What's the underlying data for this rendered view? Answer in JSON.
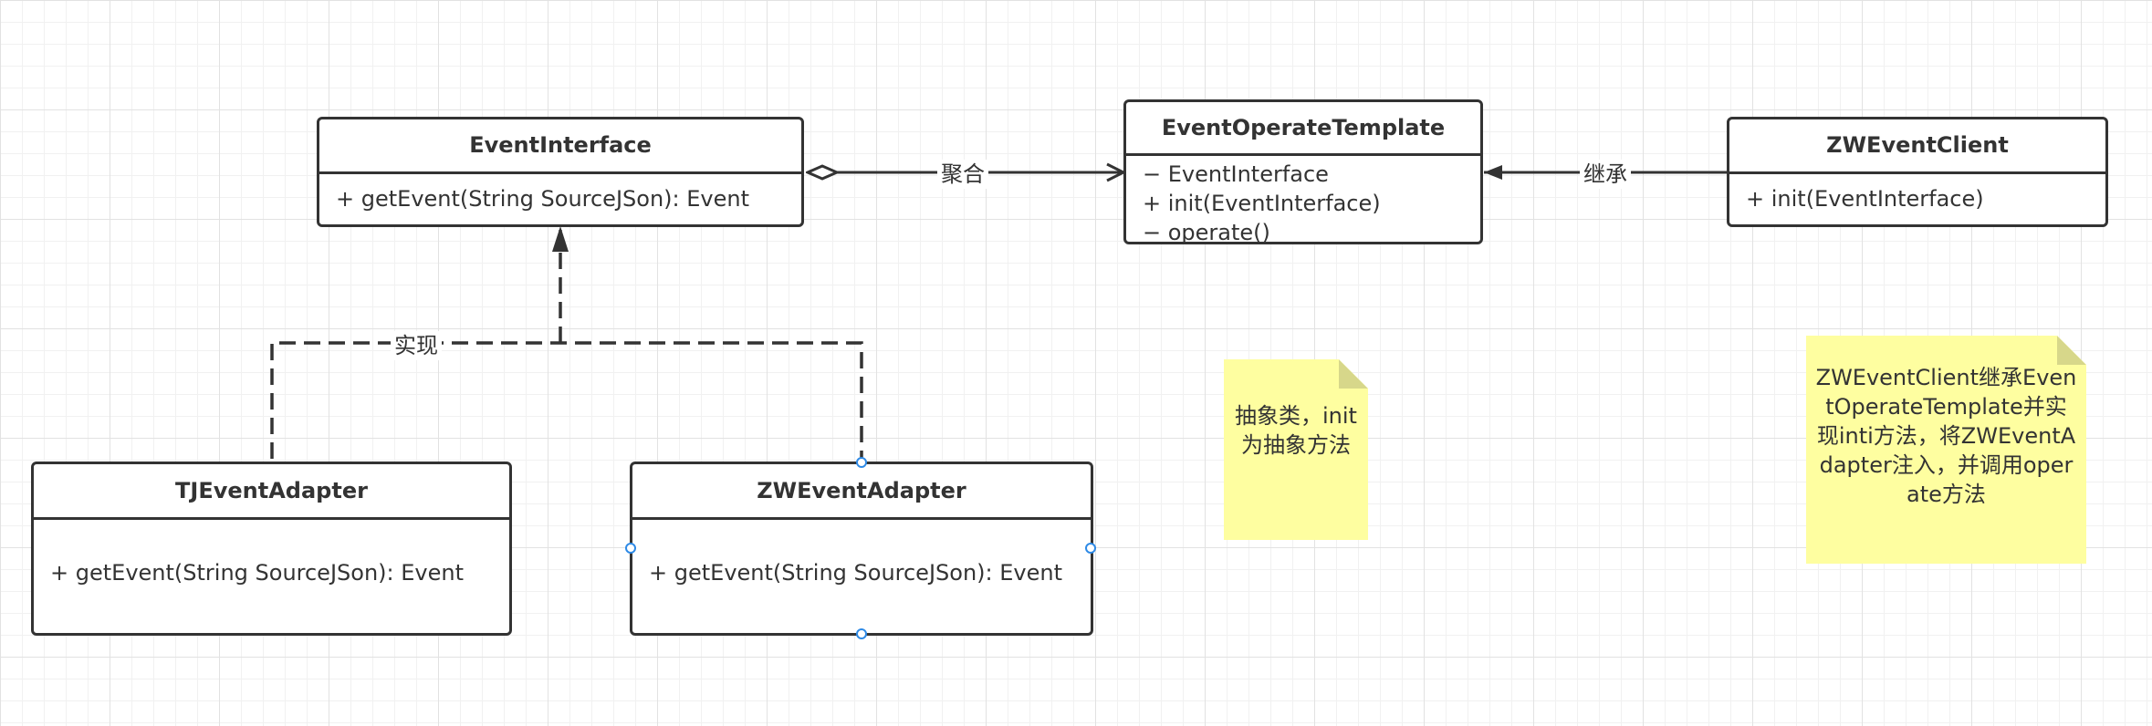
{
  "classes": {
    "event_interface": {
      "name": "EventInterface",
      "members": [
        "+ getEvent(String SourceJSon): Event"
      ]
    },
    "event_operate_template": {
      "name": "EventOperateTemplate",
      "members": [
        "− EventInterface",
        "+ init(EventInterface)",
        "− operate()"
      ]
    },
    "zw_event_client": {
      "name": "ZWEventClient",
      "members": [
        "+ init(EventInterface)"
      ]
    },
    "tj_event_adapter": {
      "name": "TJEventAdapter",
      "members": [
        "+ getEvent(String SourceJSon): Event"
      ]
    },
    "zw_event_adapter": {
      "name": "ZWEventAdapter",
      "members": [
        "+ getEvent(String SourceJSon): Event"
      ]
    }
  },
  "relations": {
    "aggregation_label": "聚合",
    "inheritance_label": "继承",
    "realization_label": "实现"
  },
  "notes": {
    "abstract_note": "抽象类，init为抽象方法",
    "client_note": "ZWEventClient继承EventOperateTemplate并实现inti方法，将ZWEventAdapter注入，并调用operate方法"
  },
  "colors": {
    "line": "#333333",
    "note_fill": "#fefea0",
    "selection_handle": "#2e8ae6"
  }
}
